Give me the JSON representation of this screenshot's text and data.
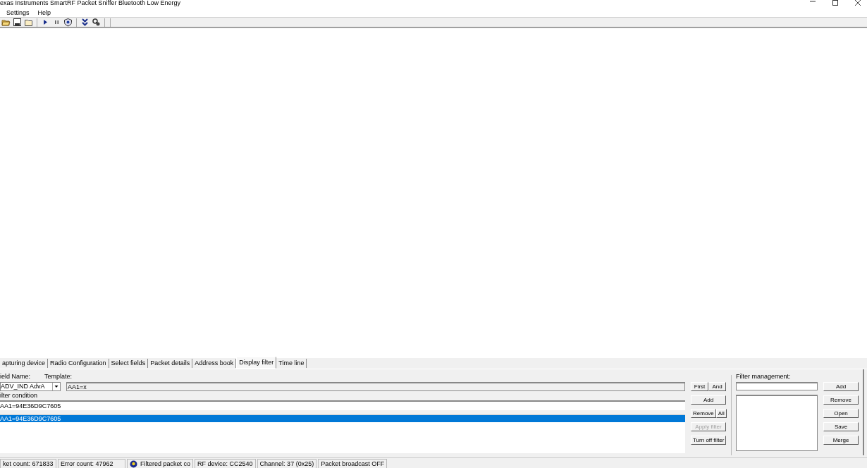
{
  "window": {
    "title": "exas Instruments SmartRF Packet Sniffer Bluetooth Low Energy"
  },
  "menu": [
    "Settings",
    "Help"
  ],
  "tabs": [
    {
      "label": "apturing device",
      "selected": false
    },
    {
      "label": "Radio Configuration",
      "selected": false
    },
    {
      "label": "Select fields",
      "selected": false
    },
    {
      "label": "Packet details",
      "selected": false
    },
    {
      "label": "Address book",
      "selected": false
    },
    {
      "label": "Display filter",
      "selected": true
    },
    {
      "label": "Time line",
      "selected": false
    }
  ],
  "display_filter": {
    "field_name_label": "ield Name:",
    "field_name_value": "ADV_IND AdvA",
    "template_label": "Template:",
    "template_value": "AA1=x",
    "condition_label": "ilter condition",
    "condition_value": "AA1=94E36D9C7605",
    "filters": [
      {
        "text": "AA1=94E36D9C7605",
        "selected": true
      }
    ],
    "button_rows": [
      {
        "buttons": [
          {
            "label": "First",
            "disabled": false
          },
          {
            "label": "And",
            "disabled": false
          }
        ]
      },
      {
        "buttons": [
          {
            "label": "Add",
            "disabled": false
          }
        ]
      },
      {
        "buttons": [
          {
            "label": "Remove",
            "disabled": false
          },
          {
            "label": "All",
            "disabled": false
          }
        ]
      },
      {
        "buttons": [
          {
            "label": "Apply filter",
            "disabled": true
          }
        ]
      },
      {
        "buttons": [
          {
            "label": "Turn off filter",
            "disabled": false
          }
        ]
      }
    ]
  },
  "filter_management": {
    "label": "Filter management:",
    "buttons": [
      "Add",
      "Remove",
      "Open",
      "Save",
      "Merge"
    ]
  },
  "status_bar": [
    {
      "text": "ket count: 671833",
      "kind": "plain"
    },
    {
      "text": "Error count: 47962",
      "kind": "plain"
    },
    {
      "text": "Filtered packet co",
      "kind": "icon"
    },
    {
      "text": "RF device: CC2540",
      "kind": "plain"
    },
    {
      "text": "Channel: 37 (0x25)",
      "kind": "plain"
    },
    {
      "text": "Packet broadcast OFF",
      "kind": "plain"
    }
  ]
}
